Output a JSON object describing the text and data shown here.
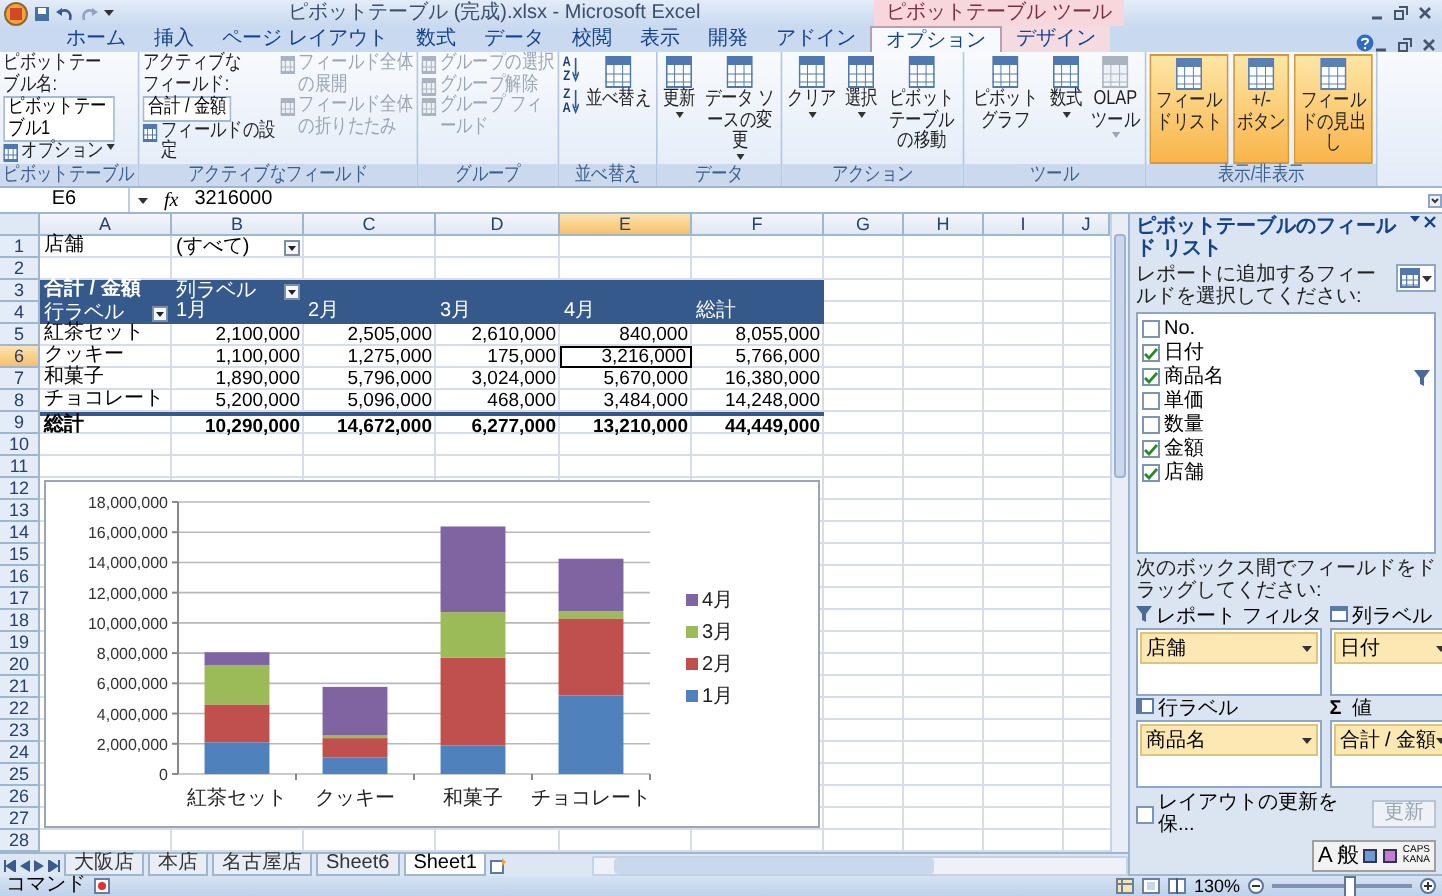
{
  "window": {
    "title": "ピボットテーブル (完成).xlsx - Microsoft Excel",
    "context_tab": "ピボットテーブル ツール"
  },
  "ribbon_tabs": [
    {
      "label": "ホーム",
      "selected": false,
      "contextual": false
    },
    {
      "label": "挿入",
      "selected": false,
      "contextual": false
    },
    {
      "label": "ページ レイアウト",
      "selected": false,
      "contextual": false
    },
    {
      "label": "数式",
      "selected": false,
      "contextual": false
    },
    {
      "label": "データ",
      "selected": false,
      "contextual": false
    },
    {
      "label": "校閲",
      "selected": false,
      "contextual": false
    },
    {
      "label": "表示",
      "selected": false,
      "contextual": false
    },
    {
      "label": "開発",
      "selected": false,
      "contextual": false
    },
    {
      "label": "アドイン",
      "selected": false,
      "contextual": false
    },
    {
      "label": "オプション",
      "selected": true,
      "contextual": true
    },
    {
      "label": "デザイン",
      "selected": false,
      "contextual": true
    }
  ],
  "ribbon_groups": [
    {
      "label": "ピボットテーブル",
      "columns": [
        [
          {
            "kind": "caption",
            "label": "ピボットテーブル名:"
          },
          {
            "kind": "field",
            "value": "ピボットテーブル1"
          },
          {
            "kind": "small",
            "label": "オプション",
            "dropdown": true,
            "disabled": false
          }
        ]
      ]
    },
    {
      "label": "アクティブなフィールド",
      "columns": [
        [
          {
            "kind": "caption",
            "label": "アクティブなフィールド:"
          },
          {
            "kind": "field",
            "value": "合計 / 金額"
          },
          {
            "kind": "small",
            "label": "フィールドの設定",
            "dropdown": false,
            "disabled": false
          }
        ],
        [
          {
            "kind": "small",
            "label": "フィールド全体の展開",
            "dropdown": false,
            "disabled": true
          },
          {
            "kind": "small",
            "label": "フィールド全体の折りたたみ",
            "dropdown": false,
            "disabled": true
          }
        ]
      ]
    },
    {
      "label": "グループ",
      "columns": [
        [
          {
            "kind": "small",
            "label": "グループの選択",
            "dropdown": false,
            "disabled": true
          },
          {
            "kind": "small",
            "label": "グループ解除",
            "dropdown": false,
            "disabled": true
          },
          {
            "kind": "small",
            "label": "グループ フィールド",
            "dropdown": false,
            "disabled": true
          }
        ]
      ]
    },
    {
      "label": "並べ替え",
      "columns": [
        [
          {
            "kind": "sort",
            "top": "A",
            "bottom": "Z"
          },
          {
            "kind": "sort",
            "top": "Z",
            "bottom": "A"
          }
        ],
        [
          {
            "kind": "large",
            "label": "並べ替え",
            "dropdown": false,
            "disabled": false,
            "on": false
          }
        ]
      ]
    },
    {
      "label": "データ",
      "columns": [
        [
          {
            "kind": "large",
            "label": "更新",
            "dropdown": true,
            "disabled": false,
            "on": false
          }
        ],
        [
          {
            "kind": "large",
            "label": "データ ソースの変更",
            "dropdown": true,
            "disabled": false,
            "on": false
          }
        ]
      ]
    },
    {
      "label": "アクション",
      "columns": [
        [
          {
            "kind": "large",
            "label": "クリア",
            "dropdown": true,
            "disabled": false,
            "on": false
          }
        ],
        [
          {
            "kind": "large",
            "label": "選択",
            "dropdown": true,
            "disabled": false,
            "on": false
          }
        ],
        [
          {
            "kind": "large",
            "label": "ピボットテーブルの移動",
            "dropdown": false,
            "disabled": false,
            "on": false
          }
        ]
      ]
    },
    {
      "label": "ツール",
      "columns": [
        [
          {
            "kind": "large",
            "label": "ピボットグラフ",
            "dropdown": false,
            "disabled": false,
            "on": false
          }
        ],
        [
          {
            "kind": "large",
            "label": "数式",
            "dropdown": true,
            "disabled": false,
            "on": false
          }
        ],
        [
          {
            "kind": "large",
            "label": "OLAP\nツール",
            "dropdown": true,
            "disabled": true,
            "on": false
          }
        ]
      ]
    },
    {
      "label": "表示/非表示",
      "columns": [
        [
          {
            "kind": "large",
            "label": "フィールドリスト",
            "dropdown": false,
            "disabled": false,
            "on": true
          }
        ],
        [
          {
            "kind": "large",
            "label": "+/-\nボタン",
            "dropdown": false,
            "disabled": false,
            "on": true
          }
        ],
        [
          {
            "kind": "large",
            "label": "フィールドの見出し",
            "dropdown": false,
            "disabled": false,
            "on": true
          }
        ]
      ]
    }
  ],
  "formula_bar": {
    "name_box": "E6",
    "fx_label": "fx",
    "formula": "3216000"
  },
  "sheet": {
    "columns": [
      {
        "label": "A",
        "selected": false
      },
      {
        "label": "B",
        "selected": false
      },
      {
        "label": "C",
        "selected": false
      },
      {
        "label": "D",
        "selected": false
      },
      {
        "label": "E",
        "selected": true
      },
      {
        "label": "F",
        "selected": false
      },
      {
        "label": "G",
        "selected": false
      },
      {
        "label": "H",
        "selected": false
      },
      {
        "label": "I",
        "selected": false
      },
      {
        "label": "J",
        "selected": false
      }
    ],
    "rows": [
      {
        "label": "1",
        "selected": false
      },
      {
        "label": "2",
        "selected": false
      },
      {
        "label": "3",
        "selected": false
      },
      {
        "label": "4",
        "selected": false
      },
      {
        "label": "5",
        "selected": false
      },
      {
        "label": "6",
        "selected": true
      },
      {
        "label": "7",
        "selected": false
      },
      {
        "label": "8",
        "selected": false
      },
      {
        "label": "9",
        "selected": false
      },
      {
        "label": "10",
        "selected": false
      },
      {
        "label": "11",
        "selected": false
      },
      {
        "label": "12",
        "selected": false
      },
      {
        "label": "13",
        "selected": false
      },
      {
        "label": "14",
        "selected": false
      },
      {
        "label": "15",
        "selected": false
      },
      {
        "label": "16",
        "selected": false
      },
      {
        "label": "17",
        "selected": false
      },
      {
        "label": "18",
        "selected": false
      },
      {
        "label": "19",
        "selected": false
      },
      {
        "label": "20",
        "selected": false
      },
      {
        "label": "21",
        "selected": false
      },
      {
        "label": "22",
        "selected": false
      },
      {
        "label": "23",
        "selected": false
      },
      {
        "label": "24",
        "selected": false
      },
      {
        "label": "25",
        "selected": false
      },
      {
        "label": "26",
        "selected": false
      },
      {
        "label": "27",
        "selected": false
      },
      {
        "label": "28",
        "selected": false
      }
    ]
  },
  "pivot": {
    "filter_label": "店舗",
    "filter_value": "(すべて)",
    "value_field": "合計 / 金額",
    "column_label": "列ラベル",
    "row_label": "行ラベル",
    "columns": [
      "1月",
      "2月",
      "3月",
      "4月",
      "総計"
    ],
    "rows": [
      {
        "label": "紅茶セット",
        "values": [
          {
            "text": "2,100,000",
            "selected": false
          },
          {
            "text": "2,505,000",
            "selected": false
          },
          {
            "text": "2,610,000",
            "selected": false
          },
          {
            "text": "840,000",
            "selected": false
          },
          {
            "text": "8,055,000",
            "selected": false
          }
        ]
      },
      {
        "label": "クッキー",
        "values": [
          {
            "text": "1,100,000",
            "selected": false
          },
          {
            "text": "1,275,000",
            "selected": false
          },
          {
            "text": "175,000",
            "selected": false
          },
          {
            "text": "3,216,000",
            "selected": true
          },
          {
            "text": "5,766,000",
            "selected": false
          }
        ]
      },
      {
        "label": "和菓子",
        "values": [
          {
            "text": "1,890,000",
            "selected": false
          },
          {
            "text": "5,796,000",
            "selected": false
          },
          {
            "text": "3,024,000",
            "selected": false
          },
          {
            "text": "5,670,000",
            "selected": false
          },
          {
            "text": "16,380,000",
            "selected": false
          }
        ]
      },
      {
        "label": "チョコレート",
        "values": [
          {
            "text": "5,200,000",
            "selected": false
          },
          {
            "text": "5,096,000",
            "selected": false
          },
          {
            "text": "468,000",
            "selected": false
          },
          {
            "text": "3,484,000",
            "selected": false
          },
          {
            "text": "14,248,000",
            "selected": false
          }
        ]
      }
    ],
    "total": {
      "label": "総計",
      "values": [
        "10,290,000",
        "14,672,000",
        "6,277,000",
        "13,210,000",
        "44,449,000"
      ]
    }
  },
  "chart_data": {
    "type": "bar",
    "stacked": true,
    "grid": true,
    "legend": true,
    "categories": [
      "紅茶セット",
      "クッキー",
      "和菓子",
      "チョコレート"
    ],
    "series": [
      {
        "name": "1月",
        "color": "#4f81bd",
        "values": [
          2100000,
          1100000,
          1890000,
          5200000
        ]
      },
      {
        "name": "2月",
        "color": "#c0504d",
        "values": [
          2505000,
          1275000,
          5796000,
          5096000
        ]
      },
      {
        "name": "3月",
        "color": "#9bbb59",
        "values": [
          2610000,
          175000,
          3024000,
          468000
        ]
      },
      {
        "name": "4月",
        "color": "#8064a2",
        "values": [
          840000,
          3216000,
          5670000,
          3484000
        ]
      }
    ],
    "ylim": [
      0,
      18000000
    ],
    "yticks": [
      {
        "value": 0,
        "label": "0"
      },
      {
        "value": 2000000,
        "label": "2,000,000"
      },
      {
        "value": 4000000,
        "label": "4,000,000"
      },
      {
        "value": 6000000,
        "label": "6,000,000"
      },
      {
        "value": 8000000,
        "label": "8,000,000"
      },
      {
        "value": 10000000,
        "label": "10,000,000"
      },
      {
        "value": 12000000,
        "label": "12,000,000"
      },
      {
        "value": 14000000,
        "label": "14,000,000"
      },
      {
        "value": 16000000,
        "label": "16,000,000"
      },
      {
        "value": 18000000,
        "label": "18,000,000"
      }
    ]
  },
  "sheet_tabs": [
    {
      "label": "大阪店",
      "selected": false
    },
    {
      "label": "本店",
      "selected": false
    },
    {
      "label": "名古屋店",
      "selected": false
    },
    {
      "label": "Sheet6",
      "selected": false
    },
    {
      "label": "Sheet1",
      "selected": true
    }
  ],
  "field_list": {
    "title": "ピボットテーブルのフィールド リスト",
    "instruction": "レポートに追加するフィールドを選択してください:",
    "fields": [
      {
        "label": "No.",
        "checked": false,
        "filtered": false
      },
      {
        "label": "日付",
        "checked": true,
        "filtered": false
      },
      {
        "label": "商品名",
        "checked": true,
        "filtered": true
      },
      {
        "label": "単価",
        "checked": false,
        "filtered": false
      },
      {
        "label": "数量",
        "checked": false,
        "filtered": false
      },
      {
        "label": "金額",
        "checked": true,
        "filtered": false
      },
      {
        "label": "店舗",
        "checked": true,
        "filtered": false
      }
    ],
    "drag_instruction": "次のボックス間でフィールドをドラッグしてください:",
    "areas": [
      {
        "kind": "filter",
        "label": "レポート フィルタ",
        "fields": [
          "店舗"
        ]
      },
      {
        "kind": "columns",
        "label": "列ラベル",
        "fields": [
          "日付"
        ]
      },
      {
        "kind": "rows",
        "label": "行ラベル",
        "fields": [
          "商品名"
        ]
      },
      {
        "kind": "values",
        "symbol": "Σ",
        "label": "値",
        "fields": [
          "合計 / 金額"
        ]
      }
    ],
    "defer_label": "レイアウトの更新を保...",
    "defer_checked": false,
    "update_button": {
      "label": "更新",
      "disabled": true
    }
  },
  "ime_bar": {
    "mode": "A",
    "input": "般",
    "caps": "CAPS",
    "kana": "KANA"
  },
  "status_bar": {
    "text": "コマンド",
    "zoom": "130%",
    "level": 0.55
  }
}
